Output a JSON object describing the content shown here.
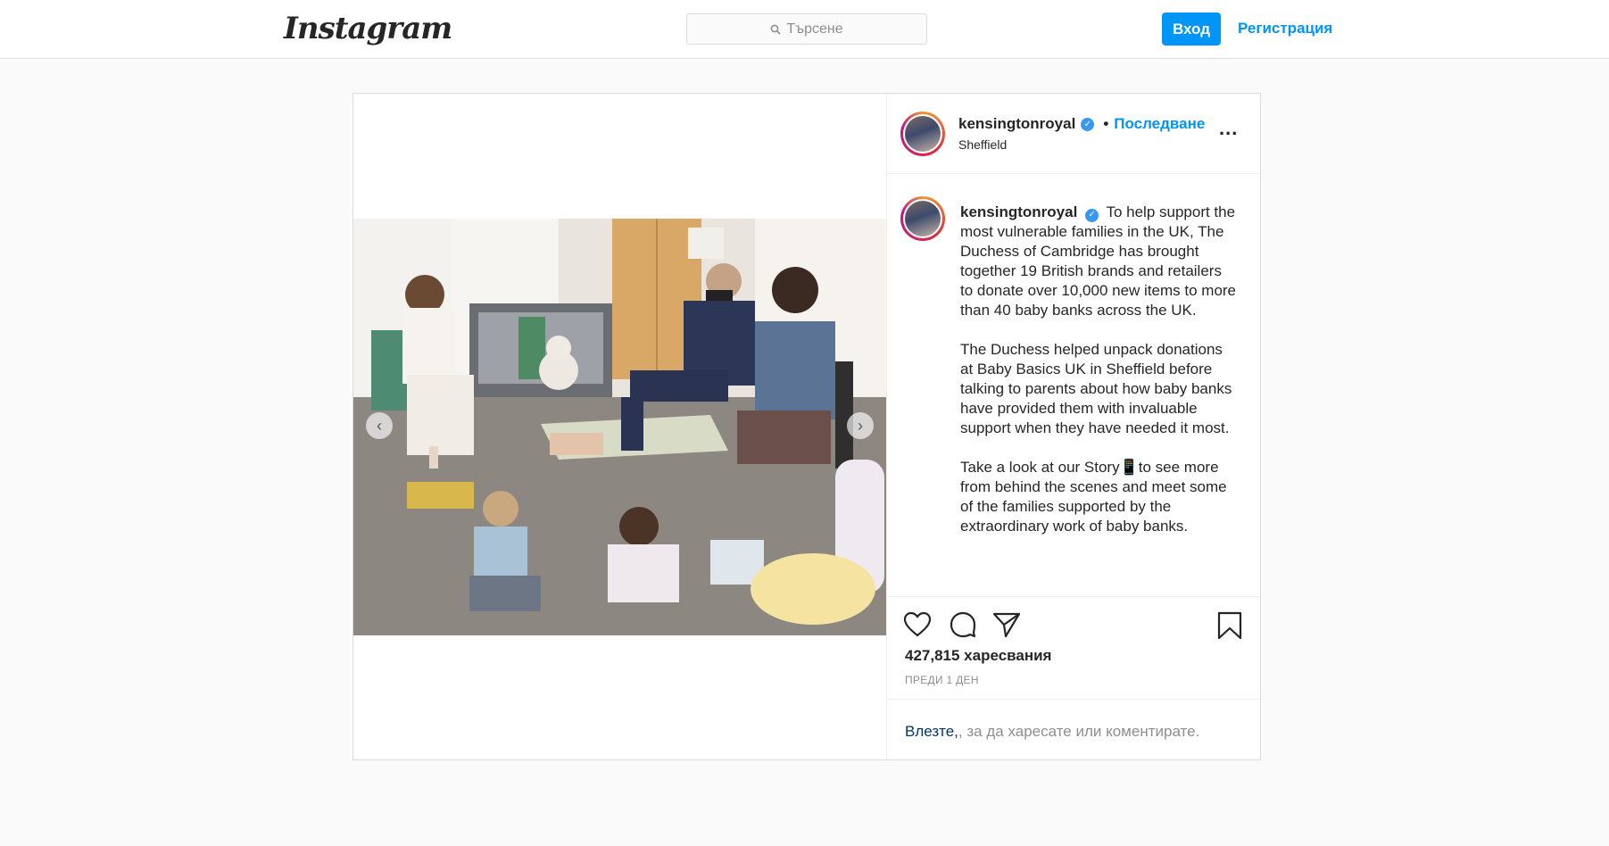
{
  "brand": {
    "logo_text": "Instagram"
  },
  "search": {
    "placeholder": "Търсене"
  },
  "auth": {
    "login_label": "Вход",
    "register_label": "Регистрация"
  },
  "post": {
    "author": {
      "username": "kensingtonroyal",
      "verified": true,
      "location": "Sheffield",
      "follow_label": "Последване"
    },
    "more_label": "...",
    "caption": {
      "username": "kensingtonroyal",
      "paragraphs": [
        "To help support the most vulnerable families in the UK, The Duchess of Cambridge has brought together 19 British brands and retailers to donate over 10,000 new items to more than 40 baby banks across the UK.",
        "The Duchess helped unpack donations at Baby Basics UK in Sheffield before talking to parents about how baby banks have provided them with invaluable support when they have needed it most.",
        "Take a look at our Story📱to see more from behind the scenes and meet some of the families supported by the extraordinary work of baby banks."
      ]
    },
    "likes_text": "427,815 харесвания",
    "time_text": "ПРЕДИ 1 ДЕН",
    "login_prompt": {
      "link": "Влезте,",
      "rest": ", за да харесате или коментирате."
    },
    "carousel": {
      "prev_icon": "chevron-left-icon",
      "next_icon": "chevron-right-icon"
    }
  },
  "colors": {
    "accent": "#0095f6",
    "border": "#dbdbdb",
    "background": "#fafafa"
  }
}
